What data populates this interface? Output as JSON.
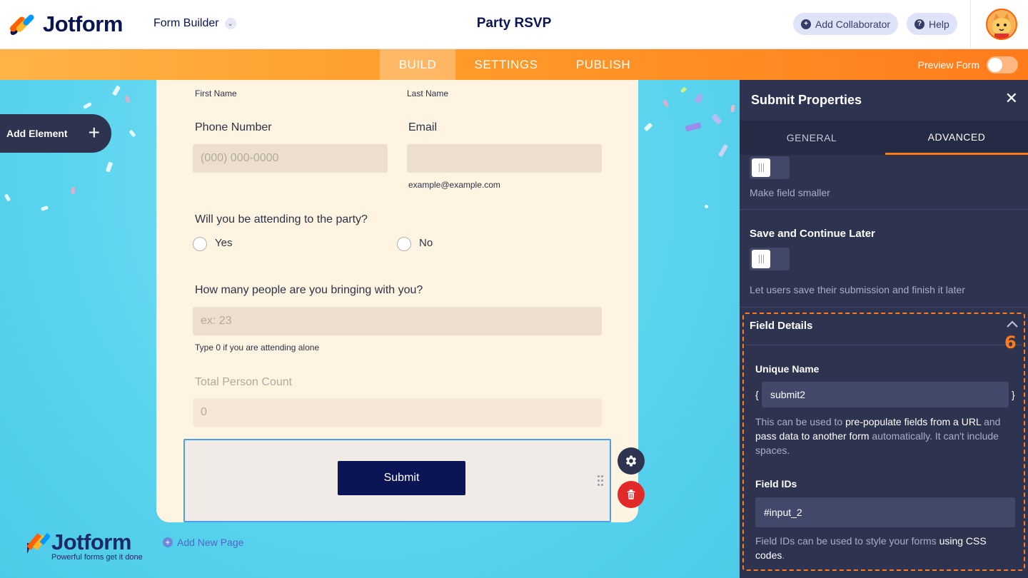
{
  "header": {
    "brand": "Jotform",
    "form_builder": "Form Builder",
    "form_title": "Party RSVP",
    "add_collaborator": "Add Collaborator",
    "help": "Help"
  },
  "nav": {
    "tabs": [
      "BUILD",
      "SETTINGS",
      "PUBLISH"
    ],
    "active": "BUILD",
    "preview_label": "Preview Form"
  },
  "canvas": {
    "add_element": "Add Element",
    "add_new_page": "Add New Page",
    "bottom_brand": "Jotform",
    "bottom_tagline": "Powerful forms get it done"
  },
  "form": {
    "first_name_label": "First Name",
    "last_name_label": "Last Name",
    "phone_label": "Phone Number",
    "phone_placeholder": "(000) 000-0000",
    "email_label": "Email",
    "email_placeholder": "",
    "email_hint": "example@example.com",
    "attending_question": "Will you be attending to the party?",
    "option_yes": "Yes",
    "option_no": "No",
    "people_question": "How many people are you bringing with you?",
    "people_placeholder": "ex: 23",
    "people_hint": "Type 0 if you are attending alone",
    "total_label": "Total Person Count",
    "total_value": "0",
    "submit_label": "Submit"
  },
  "panel": {
    "title": "Submit Properties",
    "tabs": [
      "GENERAL",
      "ADVANCED"
    ],
    "active_tab": "ADVANCED",
    "make_smaller_desc": "Make field smaller",
    "save_continue_title": "Save and Continue Later",
    "save_continue_desc": "Let users save their submission and finish it later",
    "field_details_title": "Field Details",
    "step_badge": "6",
    "unique_name_label": "Unique Name",
    "brace_open": "{",
    "brace_close": "}",
    "unique_name_value": "submit2",
    "unique_desc_1": "This can be used to ",
    "unique_desc_2": "pre-populate fields from a URL",
    "unique_desc_3": " and ",
    "unique_desc_4": "pass data to another form",
    "unique_desc_5": " automatically. It can't include spaces.",
    "field_ids_label": "Field IDs",
    "field_ids_value": "#input_2",
    "field_ids_desc_1": "Field IDs can be used to style your forms ",
    "field_ids_desc_2": "using CSS codes",
    "field_ids_desc_3": "."
  },
  "colors": {
    "brand_navy": "#0a1551",
    "orange": "#ff7b1c",
    "panel_bg": "#2e3450",
    "canvas_bg": "#5ad3ee",
    "form_bg": "#fff3e2",
    "submit_bg": "#0b1555"
  }
}
